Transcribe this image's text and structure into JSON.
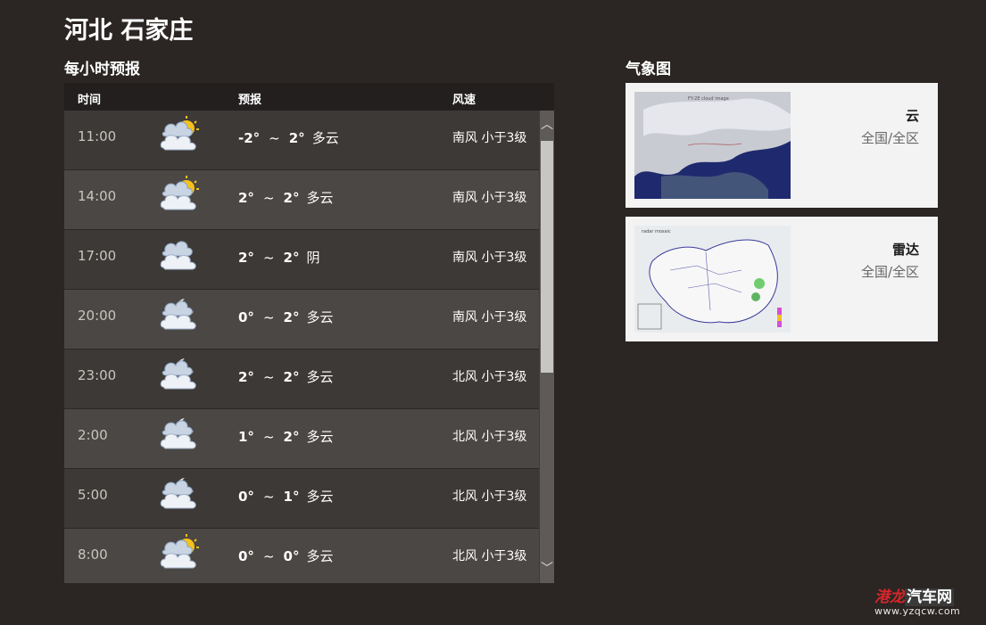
{
  "location": {
    "title": "河北 石家庄"
  },
  "hourly": {
    "title": "每小时预报",
    "headers": {
      "time": "时间",
      "forecast": "预报",
      "wind": "风速"
    },
    "rows": [
      {
        "time": "11:00",
        "icon": "partly-cloudy-sun-icon",
        "low": "-2°",
        "sep": "~",
        "high": "2°",
        "cond": "多云",
        "wind": "南风 小于3级"
      },
      {
        "time": "14:00",
        "icon": "partly-cloudy-sun-icon",
        "low": "2°",
        "sep": "~",
        "high": "2°",
        "cond": "多云",
        "wind": "南风 小于3级"
      },
      {
        "time": "17:00",
        "icon": "overcast-icon",
        "low": "2°",
        "sep": "~",
        "high": "2°",
        "cond": "阴",
        "wind": "南风 小于3级"
      },
      {
        "time": "20:00",
        "icon": "partly-cloudy-moon-icon",
        "low": "0°",
        "sep": "~",
        "high": "2°",
        "cond": "多云",
        "wind": "南风 小于3级"
      },
      {
        "time": "23:00",
        "icon": "partly-cloudy-moon-icon",
        "low": "2°",
        "sep": "~",
        "high": "2°",
        "cond": "多云",
        "wind": "北风 小于3级"
      },
      {
        "time": "2:00",
        "icon": "partly-cloudy-moon-icon",
        "low": "1°",
        "sep": "~",
        "high": "2°",
        "cond": "多云",
        "wind": "北风 小于3级"
      },
      {
        "time": "5:00",
        "icon": "partly-cloudy-moon-icon",
        "low": "0°",
        "sep": "~",
        "high": "1°",
        "cond": "多云",
        "wind": "北风 小于3级"
      },
      {
        "time": "8:00",
        "icon": "partly-cloudy-sun-icon",
        "low": "0°",
        "sep": "~",
        "high": "0°",
        "cond": "多云",
        "wind": "北风 小于3级"
      }
    ]
  },
  "maps": {
    "title": "气象图",
    "cards": [
      {
        "name": "云",
        "scope": "全国/全区",
        "thumb": "satellite-cloud-map-thumbnail"
      },
      {
        "name": "雷达",
        "scope": "全国/全区",
        "thumb": "radar-map-thumbnail"
      }
    ]
  },
  "watermark": {
    "brand_a": "港龙",
    "brand_b": "汽车网",
    "url": "www.yzqcw.com"
  },
  "colors": {
    "background": "#2b2623",
    "row_odd": "#3d3936",
    "row_even": "#4b4744",
    "header": "#221f1e",
    "card": "#f3f3f3"
  }
}
